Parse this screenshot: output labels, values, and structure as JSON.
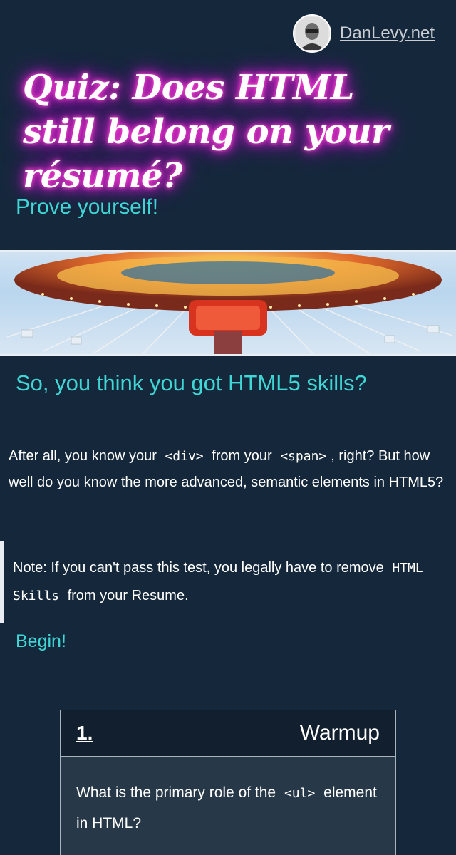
{
  "header": {
    "site_link": "DanLevy.net",
    "avatar_icon": "person-avatar"
  },
  "hero": {
    "title": "Quiz: Does HTML still belong on your résumé?",
    "subtitle": "Prove yourself!",
    "image_icon": "carousel-photo"
  },
  "intro": {
    "heading": "So, you think you got HTML5 skills?",
    "text_before_div": "After all, you know your",
    "code_div": "<div>",
    "text_between": "from your",
    "code_span": "<span>",
    "text_after": ", right? But how well do you know the more advanced, semantic elements in HTML5?"
  },
  "note": {
    "text_before": "Note: If you can't pass this test, you legally have to remove",
    "code": "HTML Skills",
    "text_after": "from your Resume."
  },
  "begin_label": "Begin!",
  "question": {
    "number": "1.",
    "category": "Warmup",
    "text_before": "What is the primary role of the",
    "code": "<ul>",
    "text_after": "element in HTML?"
  },
  "colors": {
    "background": "#15283b",
    "accent": "#3fd6d6",
    "neon": "#ff2bd0"
  }
}
